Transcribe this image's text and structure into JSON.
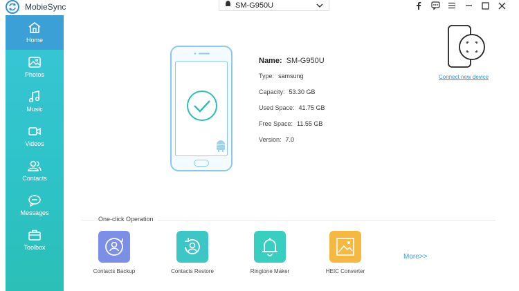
{
  "app": {
    "title": "MobieSync"
  },
  "device_selector": {
    "selected": "SM-G950U"
  },
  "window_controls": [
    "facebook-icon",
    "feedback-icon",
    "menu-icon",
    "minimize-icon",
    "maximize-icon",
    "close-icon"
  ],
  "sidebar": {
    "items": [
      {
        "label": "Home",
        "icon": "home-icon",
        "active": true
      },
      {
        "label": "Photos",
        "icon": "photo-icon",
        "active": false
      },
      {
        "label": "Music",
        "icon": "music-icon",
        "active": false
      },
      {
        "label": "Videos",
        "icon": "video-icon",
        "active": false
      },
      {
        "label": "Contacts",
        "icon": "contacts-icon",
        "active": false
      },
      {
        "label": "Messages",
        "icon": "messages-icon",
        "active": false
      },
      {
        "label": "Toolbox",
        "icon": "toolbox-icon",
        "active": false
      }
    ]
  },
  "device": {
    "name_label": "Name:",
    "name": "SM-G950U",
    "type_label": "Type:",
    "type": "samsung",
    "capacity_label": "Capacity:",
    "capacity": "53.30 GB",
    "used_label": "Used Space:",
    "used": "41.75 GB",
    "free_label": "Free Space:",
    "free": "11.55 GB",
    "version_label": "Version:",
    "version": "7.0"
  },
  "connect": {
    "label": "Connect new device"
  },
  "one_click": {
    "title": "One-click Operation",
    "items": [
      {
        "label": "Contacts Backup",
        "color": "#7b8fe6"
      },
      {
        "label": "Contacts Restore",
        "color": "#3cc6c6"
      },
      {
        "label": "Ringtone Maker",
        "color": "#39cfc0"
      },
      {
        "label": "HEIC Converter",
        "color": "#f5b942"
      }
    ],
    "more_label": "More>>"
  },
  "colors": {
    "accent": "#2d8fd6",
    "sidebar_active": "#3aa0d6",
    "sidebar_bg": "#33c4cf",
    "link": "#2f8fd8"
  }
}
